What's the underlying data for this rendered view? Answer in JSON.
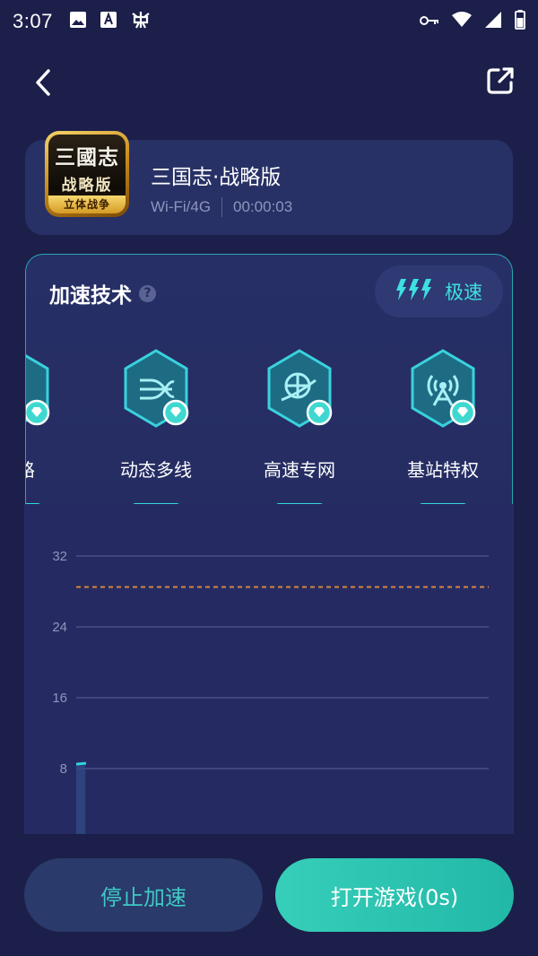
{
  "status_bar": {
    "time": "3:07",
    "left_icons": [
      "image-icon",
      "font-icon",
      "bug-icon"
    ],
    "right_icons": [
      "vpn-key-icon",
      "wifi-icon",
      "signal-icon",
      "battery-icon"
    ]
  },
  "nav": {
    "back_icon": "back-chevron-icon",
    "share_icon": "share-icon"
  },
  "game": {
    "icon_title": "三國志",
    "icon_subtitle": "战略版",
    "icon_band": "立体战争",
    "name": "三国志·战略版",
    "network": "Wi-Fi/4G",
    "elapsed": "00:00:03"
  },
  "tech": {
    "title": "加速技术",
    "help_icon": "?",
    "speed_label": "极速",
    "accent": "#3ee0e0",
    "features": [
      {
        "label": "双路",
        "icon": "dual-route-icon"
      },
      {
        "label": "动态多线",
        "icon": "dynamic-multiline-icon"
      },
      {
        "label": "高速专网",
        "icon": "globe-network-icon"
      },
      {
        "label": "基站特权",
        "icon": "base-station-icon"
      }
    ]
  },
  "chart_data": {
    "type": "line",
    "y_ticks": [
      "32",
      "24",
      "16",
      "8"
    ],
    "ylim": [
      0,
      36
    ],
    "reference_line": 28.5,
    "series": [
      {
        "values": [
          8.5
        ]
      }
    ],
    "line_color": "#2fd8e0",
    "reference_color": "#e08a3c"
  },
  "buttons": {
    "stop": "停止加速",
    "open": "打开游戏(0s)"
  }
}
